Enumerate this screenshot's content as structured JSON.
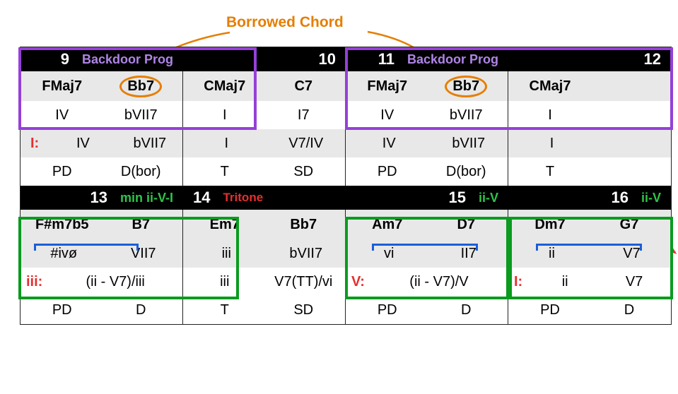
{
  "title": "Borrowed Chord",
  "block1": {
    "measures": [
      "9",
      "10",
      "11",
      "12"
    ],
    "progLabel": "Backdoor Prog",
    "chords": [
      [
        "FMaj7",
        "Bb7"
      ],
      [
        "CMaj7",
        "C7"
      ],
      [
        "FMaj7",
        "Bb7"
      ],
      [
        "CMaj7",
        ""
      ]
    ],
    "roman1": [
      [
        "IV",
        "bVII7"
      ],
      [
        "I",
        "I7"
      ],
      [
        "IV",
        "bVII7"
      ],
      [
        "I",
        ""
      ]
    ],
    "roman2": [
      [
        "IV",
        "bVII7"
      ],
      [
        "I",
        "V7/IV"
      ],
      [
        "IV",
        "bVII7"
      ],
      [
        "I",
        ""
      ]
    ],
    "roman2key": "I:",
    "func": [
      [
        "PD",
        "D(bor)"
      ],
      [
        "T",
        "SD"
      ],
      [
        "PD",
        "D(bor)"
      ],
      [
        "T",
        ""
      ]
    ]
  },
  "block2": {
    "measures": [
      "13",
      "14",
      "15",
      "16"
    ],
    "progLabels": [
      "min ii-V-I",
      "Tritone",
      "ii-V",
      "ii-V"
    ],
    "chords": [
      [
        "F#m7b5",
        "B7"
      ],
      [
        "Em7",
        "Bb7"
      ],
      [
        "Am7",
        "D7"
      ],
      [
        "Dm7",
        "G7"
      ]
    ],
    "roman1": [
      [
        "#ivø",
        "VII7"
      ],
      [
        "iii",
        "bVII7"
      ],
      [
        "vi",
        "II7"
      ],
      [
        "ii",
        "V7"
      ]
    ],
    "roman2": [
      [
        "(ii - V7)/iii",
        ""
      ],
      [
        "iii",
        "V7(TT)/vi"
      ],
      [
        "(ii - V7)/V",
        ""
      ],
      [
        "ii",
        "V7"
      ]
    ],
    "roman2keys": [
      "iii:",
      "",
      "V:",
      "I:"
    ],
    "func": [
      [
        "PD",
        "D"
      ],
      [
        "T",
        "SD"
      ],
      [
        "PD",
        "D"
      ],
      [
        "PD",
        "D"
      ]
    ]
  }
}
